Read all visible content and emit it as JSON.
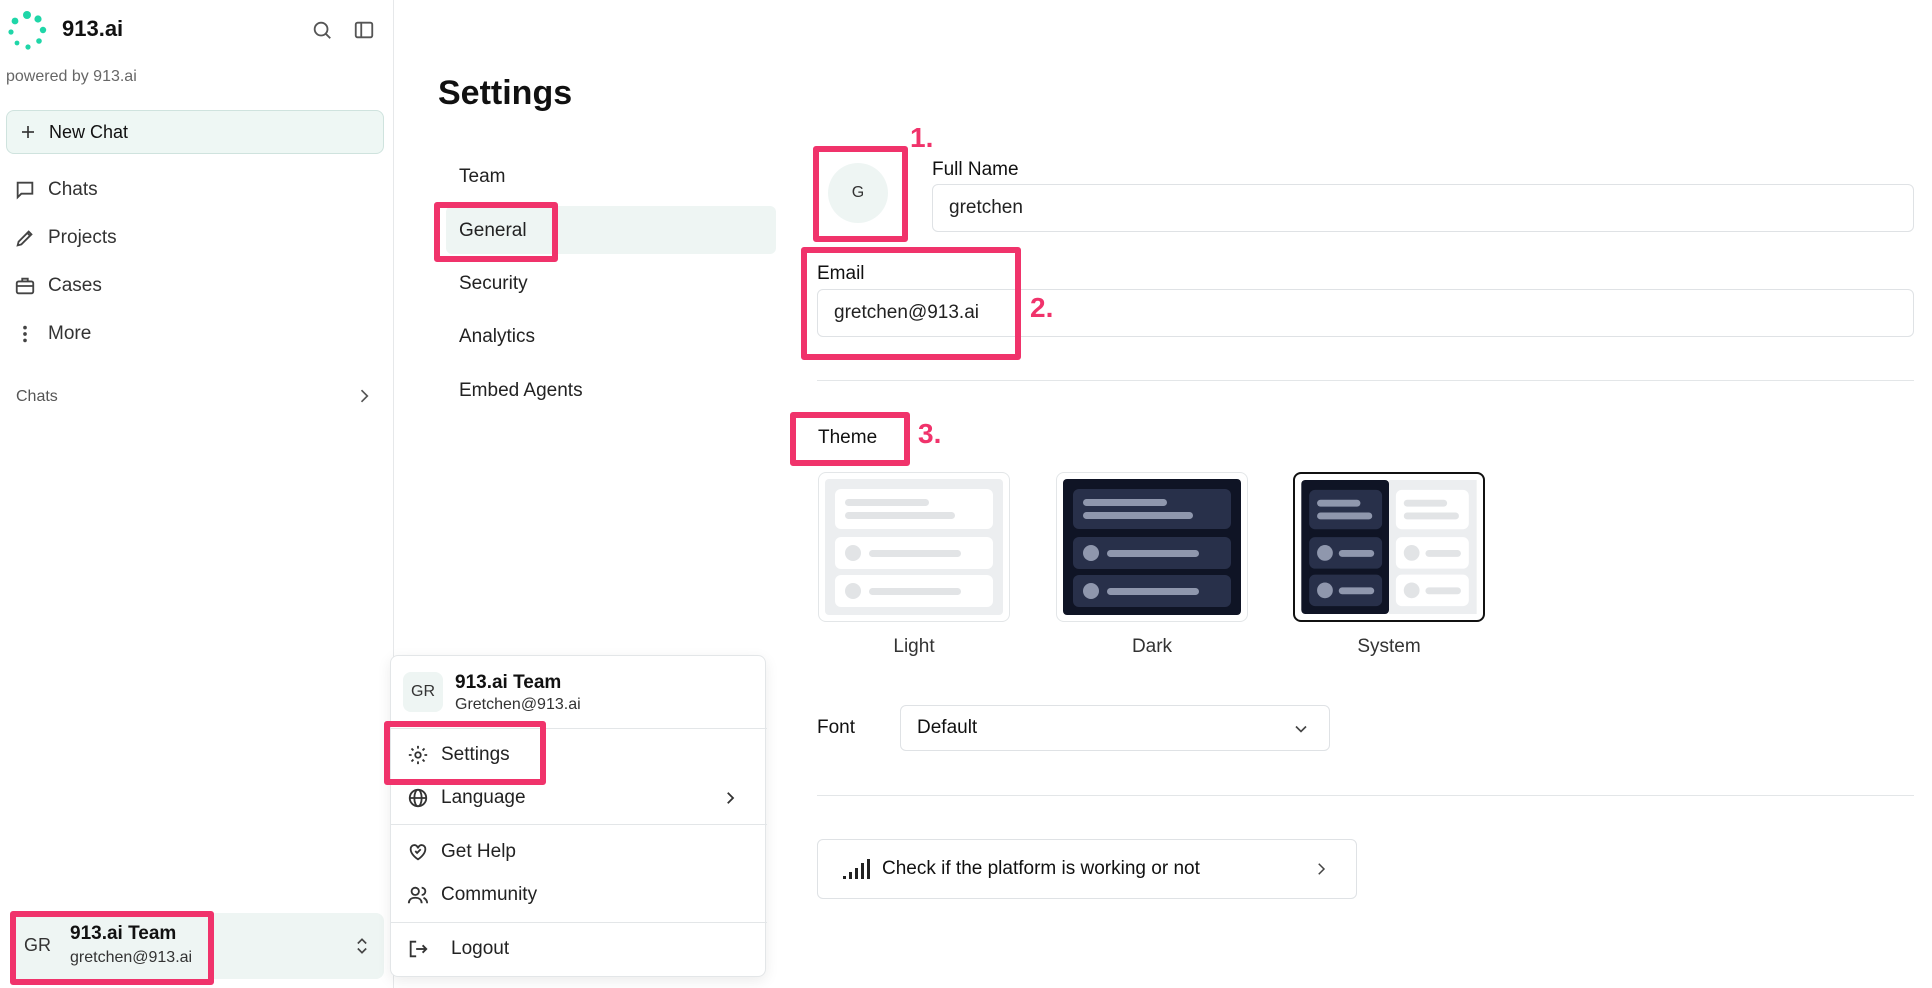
{
  "sidebar": {
    "brand": "913.ai",
    "powered_by": "powered by 913.ai",
    "new_chat_label": "New Chat",
    "nav": [
      {
        "label": "Chats",
        "icon": "message-icon"
      },
      {
        "label": "Projects",
        "icon": "pen-icon"
      },
      {
        "label": "Cases",
        "icon": "briefcase-icon"
      },
      {
        "label": "More",
        "icon": "more-vertical-icon"
      }
    ],
    "section_label": "Chats",
    "account": {
      "initials": "GR",
      "name": "913.ai Team",
      "email": "gretchen@913.ai"
    }
  },
  "main": {
    "title": "Settings",
    "tabs": [
      "Team",
      "General",
      "Security",
      "Analytics",
      "Embed Agents"
    ],
    "active_tab": "General",
    "avatar_initial": "G",
    "full_name_label": "Full Name",
    "full_name_value": "gretchen",
    "email_label": "Email",
    "email_value": "gretchen@913.ai",
    "theme_label": "Theme",
    "themes": [
      "Light",
      "Dark",
      "System"
    ],
    "selected_theme": "System",
    "font_label": "Font",
    "font_value": "Default",
    "status_text": "Check if the platform is working or not"
  },
  "menu": {
    "initials": "GR",
    "name": "913.ai Team",
    "email": "Gretchen@913.ai",
    "items": [
      "Settings",
      "Language",
      "Get Help",
      "Community",
      "Logout"
    ]
  },
  "annotations": {
    "one": "1.",
    "two": "2.",
    "three": "3."
  },
  "colors": {
    "accent": "#f0336b",
    "brand": "#1fd6a8",
    "active_bg": "#eef5f3"
  }
}
